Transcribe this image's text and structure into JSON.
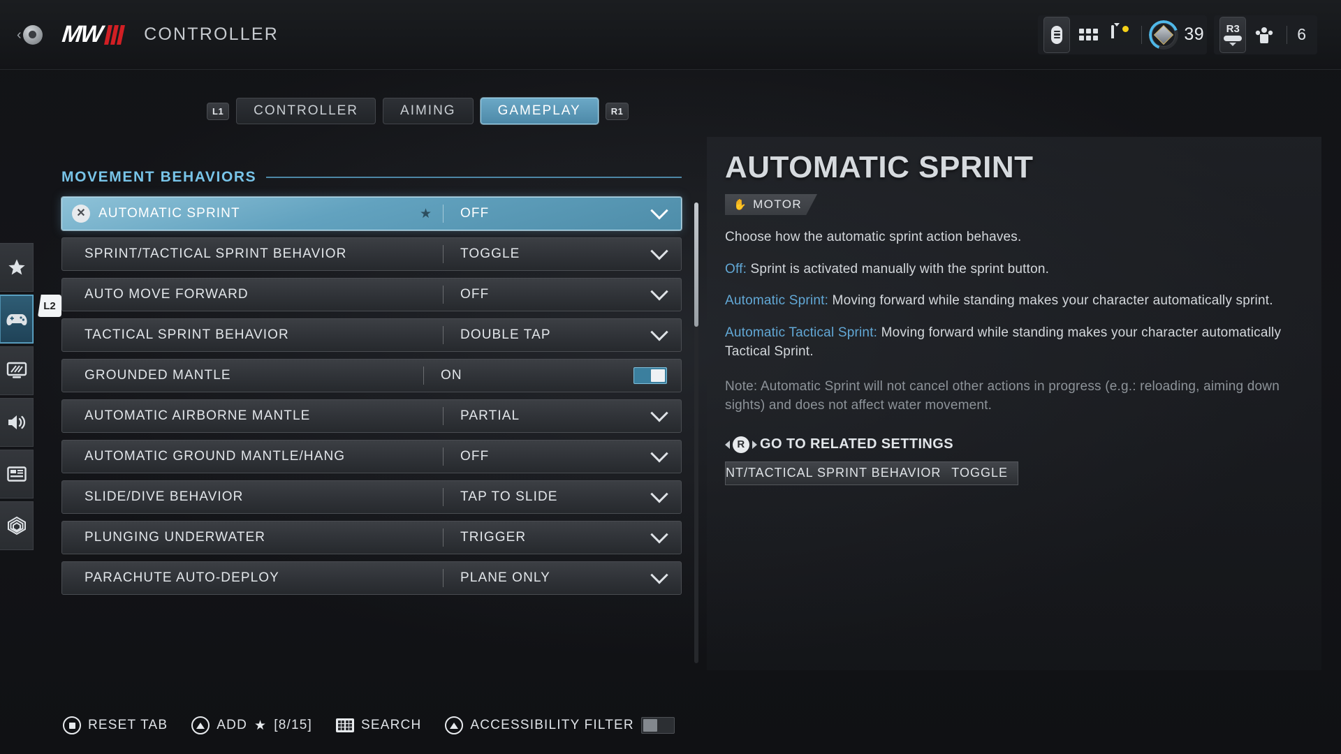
{
  "header": {
    "back_icon": "back-circle-icon",
    "logo_text": "MW",
    "logo_numerals": "III",
    "page_title": "CONTROLLER"
  },
  "hud": {
    "battery_icon": "battery-icon",
    "apps_icon": "apps-grid-icon",
    "notifications_icon": "bell-icon",
    "rank_icon": "rank-emblem-icon",
    "rank_level": "39",
    "r3_label": "R3",
    "squad_icon": "squad-icon",
    "squad_count": "6"
  },
  "tabs": {
    "left_bumper": "L1",
    "right_bumper": "R1",
    "items": [
      {
        "label": "CONTROLLER",
        "active": false
      },
      {
        "label": "AIMING",
        "active": false
      },
      {
        "label": "GAMEPLAY",
        "active": true
      }
    ]
  },
  "rail": {
    "l2_badge": "L2",
    "items": [
      {
        "icon": "star-icon",
        "active": false
      },
      {
        "icon": "gamepad-icon",
        "active": true
      },
      {
        "icon": "display-icon",
        "active": false
      },
      {
        "icon": "speaker-icon",
        "active": false
      },
      {
        "icon": "interface-icon",
        "active": false
      },
      {
        "icon": "accessibility-icon",
        "active": false
      }
    ]
  },
  "settings": {
    "section_title": "MOVEMENT BEHAVIORS",
    "rows": [
      {
        "label": "AUTOMATIC SPRINT",
        "value": "OFF",
        "control": "dropdown",
        "selected": true,
        "favorite": true
      },
      {
        "label": "SPRINT/TACTICAL SPRINT BEHAVIOR",
        "value": "TOGGLE",
        "control": "dropdown",
        "selected": false,
        "favorite": false
      },
      {
        "label": "AUTO MOVE FORWARD",
        "value": "OFF",
        "control": "dropdown",
        "selected": false,
        "favorite": false
      },
      {
        "label": "TACTICAL SPRINT BEHAVIOR",
        "value": "DOUBLE TAP",
        "control": "dropdown",
        "selected": false,
        "favorite": false
      },
      {
        "label": "GROUNDED MANTLE",
        "value": "ON",
        "control": "toggle",
        "selected": false,
        "favorite": false,
        "toggle_on": true
      },
      {
        "label": "AUTOMATIC AIRBORNE MANTLE",
        "value": "PARTIAL",
        "control": "dropdown",
        "selected": false,
        "favorite": false
      },
      {
        "label": "AUTOMATIC GROUND MANTLE/HANG",
        "value": "OFF",
        "control": "dropdown",
        "selected": false,
        "favorite": false
      },
      {
        "label": "SLIDE/DIVE BEHAVIOR",
        "value": "TAP TO SLIDE",
        "control": "dropdown",
        "selected": false,
        "favorite": false
      },
      {
        "label": "PLUNGING UNDERWATER",
        "value": "TRIGGER",
        "control": "dropdown",
        "selected": false,
        "favorite": false
      },
      {
        "label": "PARACHUTE AUTO-DEPLOY",
        "value": "PLANE ONLY",
        "control": "dropdown",
        "selected": false,
        "favorite": false
      }
    ]
  },
  "detail": {
    "title": "AUTOMATIC SPRINT",
    "badge_label": "MOTOR",
    "badge_icon": "hand-icon",
    "description": "Choose how the automatic sprint action behaves.",
    "options": [
      {
        "name": "Off:",
        "text": " Sprint is activated manually with the sprint button."
      },
      {
        "name": "Automatic Sprint:",
        "text": " Moving forward while standing makes your character automatically sprint."
      },
      {
        "name": "Automatic Tactical Sprint:",
        "text": " Moving forward while standing makes your character automatically Tactical Sprint."
      }
    ],
    "note": "Note: Automatic Sprint will not cancel other actions in progress (e.g.: reloading, aiming down sights) and does not affect water movement.",
    "related_header": "GO TO RELATED SETTINGS",
    "related_button": "R",
    "related_card": {
      "label": "INT/TACTICAL SPRINT BEHAVIOR",
      "value": "TOGGLE"
    }
  },
  "bottom_bar": {
    "reset_label": "RESET TAB",
    "add_label": "ADD",
    "add_count": "[8/15]",
    "search_label": "SEARCH",
    "accessibility_label": "ACCESSIBILITY FILTER",
    "accessibility_on": false
  },
  "colors": {
    "accent_blue": "#78c4e8",
    "selected_row": "#62a2bf",
    "brand_red": "#d11f24",
    "notification_dot": "#f5d118"
  }
}
